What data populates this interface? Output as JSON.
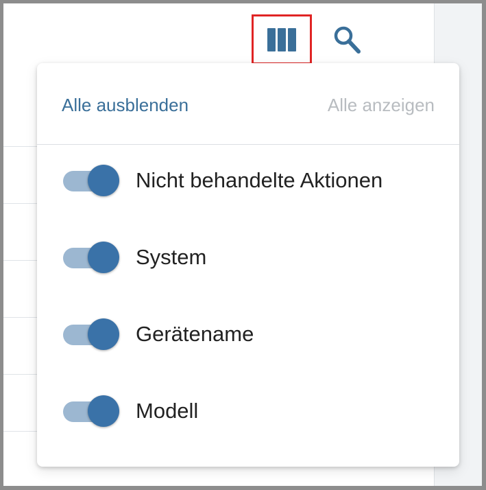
{
  "toolbar": {
    "columns_icon": "view-column-icon",
    "search_icon": "search-icon",
    "highlight_color": "#e02424",
    "icon_color": "#3a6f99"
  },
  "popover": {
    "hide_all_label": "Alle ausblenden",
    "show_all_label": "Alle anzeigen",
    "items": [
      {
        "label": "Nicht behandelte Aktionen",
        "checked": true
      },
      {
        "label": "System",
        "checked": true
      },
      {
        "label": "Gerätename",
        "checked": true
      },
      {
        "label": "Modell",
        "checked": true
      }
    ],
    "switch_on_color": "#3a72a8"
  }
}
